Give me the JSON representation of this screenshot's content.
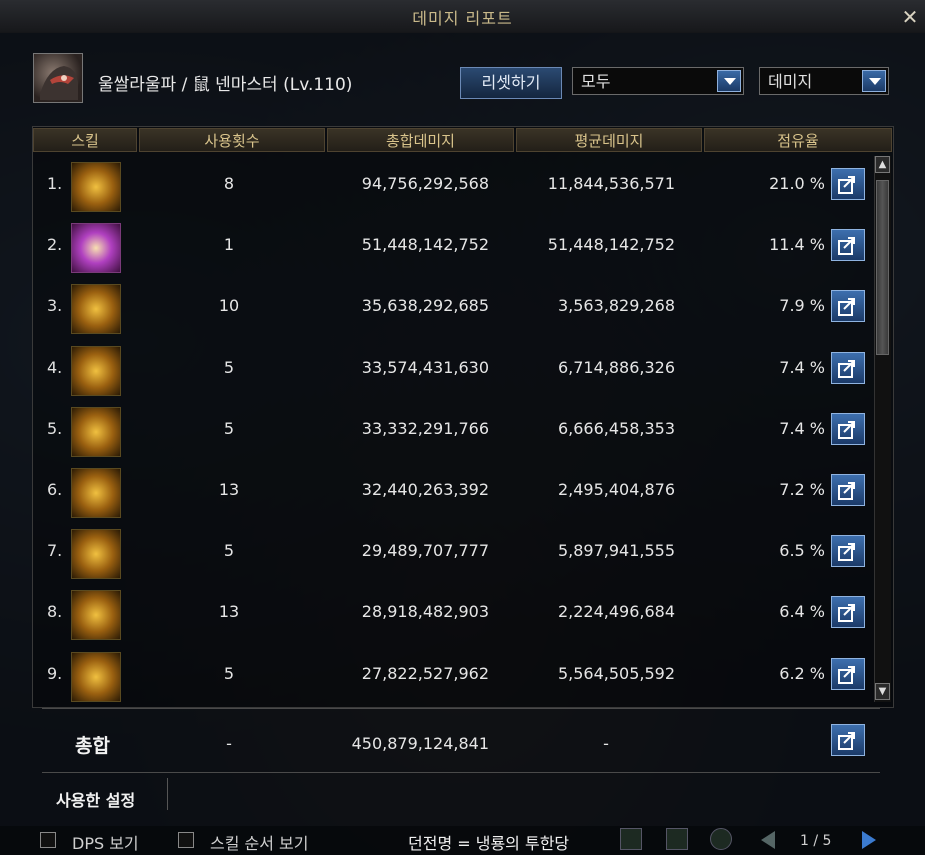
{
  "window": {
    "title": "데미지 리포트"
  },
  "header": {
    "character": "울쌀라울파 / 鼠 넨마스터 (Lv.110)",
    "reset_label": "리셋하기",
    "filter_selected": "모두",
    "metric_selected": "데미지"
  },
  "columns": [
    "스킬",
    "사용횟수",
    "총합데미지",
    "평균데미지",
    "점유율"
  ],
  "rows": [
    {
      "num": "1.",
      "icon": "golden-burst-skill-icon",
      "count": "8",
      "total": "94,756,292,568",
      "avg": "11,844,536,571",
      "share": "21.0 %"
    },
    {
      "num": "2.",
      "icon": "purple-aura-skill-icon",
      "count": "1",
      "total": "51,448,142,752",
      "avg": "51,448,142,752",
      "share": "11.4 %"
    },
    {
      "num": "3.",
      "icon": "ring-sigil-skill-icon",
      "count": "10",
      "total": "35,638,292,685",
      "avg": "3,563,829,268",
      "share": "7.9 %"
    },
    {
      "num": "4.",
      "icon": "sun-orb-skill-icon",
      "count": "5",
      "total": "33,574,431,630",
      "avg": "6,714,886,326",
      "share": "7.4 %"
    },
    {
      "num": "5.",
      "icon": "lion-skill-icon",
      "count": "5",
      "total": "33,332,291,766",
      "avg": "6,666,458,353",
      "share": "7.4 %"
    },
    {
      "num": "6.",
      "icon": "radiant-fist-skill-icon",
      "count": "13",
      "total": "32,440,263,392",
      "avg": "2,495,404,876",
      "share": "7.2 %"
    },
    {
      "num": "7.",
      "icon": "spinning-orb-skill-icon",
      "count": "5",
      "total": "29,489,707,777",
      "avg": "5,897,941,555",
      "share": "6.5 %"
    },
    {
      "num": "8.",
      "icon": "tiger-face-skill-icon",
      "count": "13",
      "total": "28,918,482,903",
      "avg": "2,224,496,684",
      "share": "6.4 %"
    },
    {
      "num": "9.",
      "icon": "dash-beast-skill-icon",
      "count": "5",
      "total": "27,822,527,962",
      "avg": "5,564,505,592",
      "share": "6.2 %"
    }
  ],
  "total": {
    "label": "총합",
    "count": "-",
    "total": "450,879,124,841",
    "avg": "-"
  },
  "settings_label": "사용한 설정",
  "footer": {
    "dps_label": "DPS 보기",
    "skill_order_label": "스킬 순서 보기",
    "dungeon_label": "던전명 = 냉룡의 투한당",
    "page": "1 / 5"
  },
  "colors": {
    "accent_gold": "#d9c48c",
    "button_blue": "#3d6fae"
  }
}
